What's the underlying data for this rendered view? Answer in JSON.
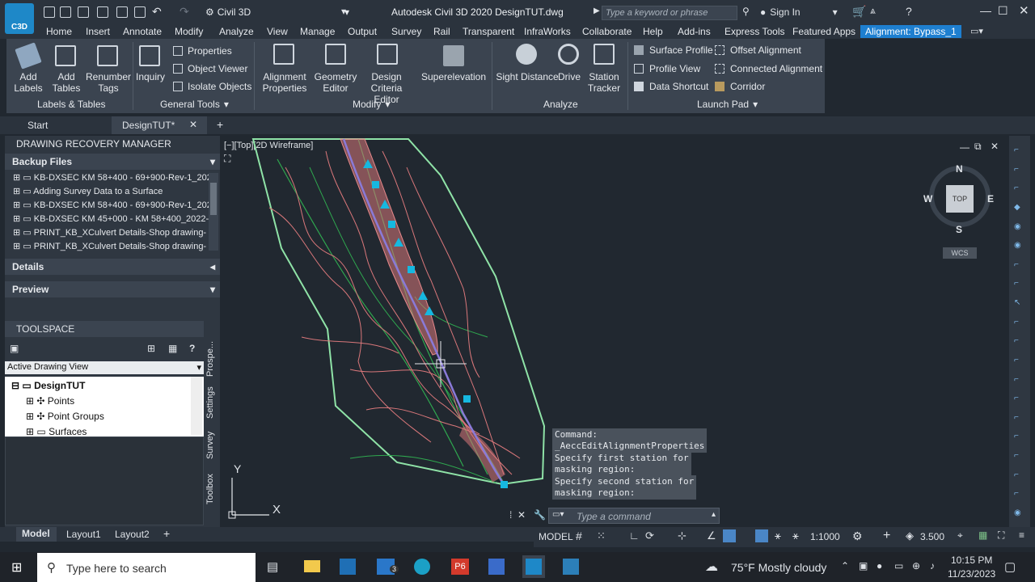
{
  "title_bar": {
    "app_icon_label": "C3D",
    "workspace": "Civil 3D",
    "title": "Autodesk Civil 3D 2020  DesignTUT.dwg",
    "search_placeholder": "Type a keyword or phrase",
    "sign_in": "Sign In"
  },
  "ribbon_tabs": [
    "Home",
    "Insert",
    "Annotate",
    "Modify",
    "Analyze",
    "View",
    "Manage",
    "Output",
    "Survey",
    "Rail",
    "Transparent",
    "InfraWorks",
    "Collaborate",
    "Help",
    "Add-ins",
    "Express Tools",
    "Featured Apps",
    "Alignment: Bypass_1"
  ],
  "ribbon": {
    "labels_tables": {
      "add_labels": "Add Labels",
      "add_tables": "Add Tables",
      "renumber_tags": "Renumber Tags",
      "panel": "Labels & Tables"
    },
    "general_tools": {
      "inquiry": "Inquiry",
      "properties": "Properties",
      "object_viewer": "Object Viewer",
      "isolate_objects": "Isolate Objects",
      "panel": "General Tools"
    },
    "modify": {
      "alignment_properties": "Alignment Properties",
      "geometry_editor": "Geometry Editor",
      "design_criteria_editor": "Design Criteria Editor",
      "superelevation": "Superelevation",
      "panel": "Modify"
    },
    "analyze": {
      "sight_distance": "Sight Distance",
      "drive": "Drive",
      "station_tracker": "Station Tracker",
      "panel": "Analyze"
    },
    "launch_pad": {
      "surface_profile": "Surface Profile",
      "profile_view": "Profile View",
      "data_shortcut": "Data Shortcut",
      "offset_alignment": "Offset Alignment",
      "connected_alignment": "Connected Alignment",
      "corridor": "Corridor",
      "panel": "Launch Pad"
    }
  },
  "doc_tabs": {
    "start": "Start",
    "active": "DesignTUT*"
  },
  "recovery": {
    "title": "DRAWING RECOVERY MANAGER",
    "backup_header": "Backup Files",
    "files": [
      "KB-DXSEC KM 58+400 - 69+900-Rev-1_202",
      "Adding  Survey Data to a Surface",
      "KB-DXSEC KM 58+400 - 69+900-Rev-1_202",
      "KB-DXSEC KM 45+000 - KM 58+400_2022-",
      "PRINT_KB_XCulvert Details-Shop drawing-",
      "PRINT_KB_XCulvert Details-Shop drawing-"
    ],
    "details": "Details",
    "preview": "Preview"
  },
  "toolspace": {
    "title": "TOOLSPACE",
    "view": "Active Drawing View",
    "tree": {
      "root": "DesignTUT",
      "items": [
        "Points",
        "Point Groups",
        "Surfaces"
      ]
    },
    "side_tabs": [
      "Prospe...",
      "Settings",
      "Survey",
      "Toolbox"
    ]
  },
  "viewport": {
    "label": "[−][Top][2D Wireframe]",
    "viewcube": {
      "n": "N",
      "s": "S",
      "e": "E",
      "w": "W",
      "top": "TOP",
      "wcs": "WCS"
    },
    "ucs": {
      "x": "X",
      "y": "Y"
    }
  },
  "command": {
    "history": [
      "Command:\n_AeccEditAlignmentProperties",
      "Specify first station for\nmasking region:",
      "Specify second station for\nmasking region:"
    ],
    "placeholder": "Type a command"
  },
  "layout_tabs": [
    "Model",
    "Layout1",
    "Layout2"
  ],
  "status_bar": {
    "model": "MODEL",
    "scale": "1:1000",
    "annotation": "3.500"
  },
  "taskbar": {
    "search": "Type here to search",
    "weather": "75°F  Mostly cloudy",
    "time": "10:15 PM",
    "date": "11/23/2023",
    "mail_badge": "3"
  },
  "colors": {
    "accent": "#1e7fd0",
    "viewport_bg": "#212830",
    "contour_pink": "#d9777a",
    "contour_green": "#2fa84f",
    "boundary": "#8fe3a7",
    "alignment": "#8a7ad8",
    "marker": "#16b8e0"
  }
}
